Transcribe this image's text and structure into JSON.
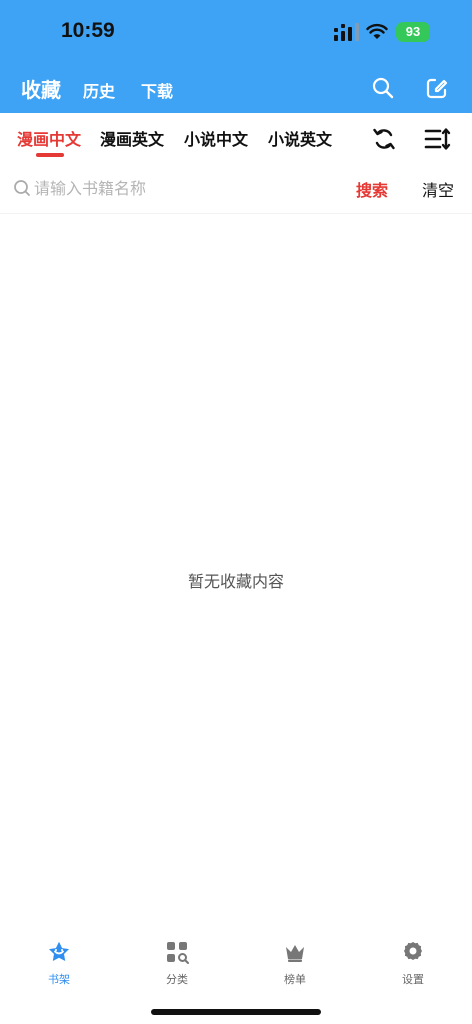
{
  "status_bar": {
    "time": "10:59",
    "battery_level": "93"
  },
  "header": {
    "tabs": [
      {
        "label": "收藏",
        "active": true
      },
      {
        "label": "历史",
        "active": false
      },
      {
        "label": "下载",
        "active": false
      }
    ],
    "icons": [
      "search-icon",
      "edit-icon"
    ],
    "background_color": "#3EA3F5"
  },
  "categories": {
    "items": [
      {
        "label": "漫画中文",
        "selected": true
      },
      {
        "label": "漫画英文",
        "selected": false
      },
      {
        "label": "小说中文",
        "selected": false
      },
      {
        "label": "小说英文",
        "selected": false
      }
    ],
    "icons": [
      "refresh-icon",
      "sort-icon"
    ],
    "selected_color": "#E53935"
  },
  "search": {
    "placeholder": "请输入书籍名称",
    "value": "",
    "search_label": "搜索",
    "clear_label": "清空"
  },
  "main": {
    "empty_message": "暂无收藏内容"
  },
  "bottom_nav": {
    "items": [
      {
        "label": "书架",
        "icon": "bookshelf-icon",
        "active": true
      },
      {
        "label": "分类",
        "icon": "category-icon",
        "active": false
      },
      {
        "label": "榜单",
        "icon": "crown-icon",
        "active": false
      },
      {
        "label": "设置",
        "icon": "gear-icon",
        "active": false
      }
    ],
    "active_color": "#2F8EF0"
  }
}
